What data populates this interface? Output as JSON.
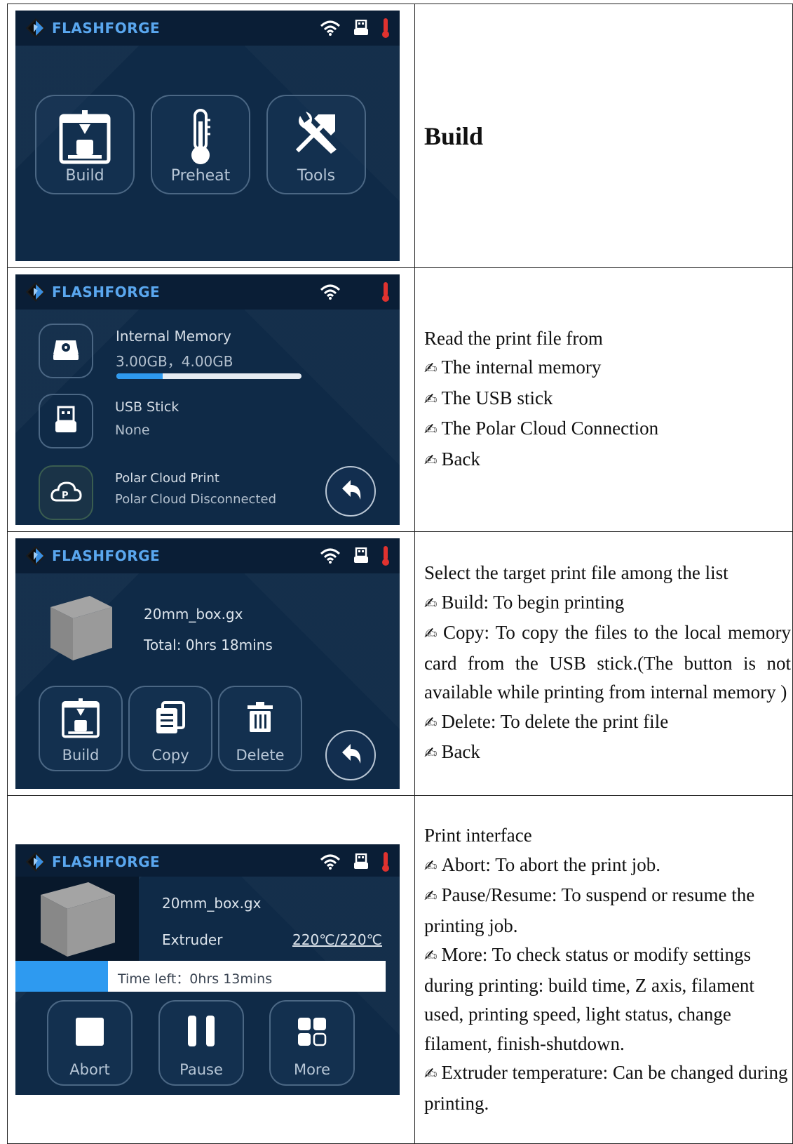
{
  "rows": [
    {
      "screen": {
        "brand": "FLASHFORGE",
        "tiles": [
          "Build",
          "Preheat",
          "Tools"
        ]
      },
      "heading": "Build"
    },
    {
      "screen": {
        "brand": "FLASHFORGE",
        "internal_title": "Internal Memory",
        "internal_value": "3.00GB，4.00GB",
        "internal_used_fraction": 0.25,
        "usb_title": "USB Stick",
        "usb_value": "None",
        "cloud_title": "Polar Cloud Print",
        "cloud_value": "Polar Cloud Disconnected"
      },
      "lines": [
        "Read the print file from"
      ],
      "bullets": [
        "The internal memory",
        "The USB stick",
        "The Polar Cloud Connection",
        "Back"
      ]
    },
    {
      "screen": {
        "brand": "FLASHFORGE",
        "file_name": "20mm_box.gx",
        "total": "Total: 0hrs 18mins",
        "tiles": [
          "Build",
          "Copy",
          "Delete"
        ]
      },
      "intro": "Select the target print file among the list",
      "bullets": [
        "Build: To begin printing",
        "Copy: To copy the files to the local memory card from the USB stick.(The button is not available while printing from internal memory )",
        "Delete: To delete the print file",
        "Back"
      ]
    },
    {
      "screen": {
        "brand": "FLASHFORGE",
        "file_name": "20mm_box.gx",
        "extruder_label": "Extruder",
        "extruder_value": "220℃/220℃",
        "time_left": "Time left：0hrs 13mins",
        "progress_fraction": 0.25,
        "tiles": [
          "Abort",
          "Pause",
          "More"
        ]
      },
      "intro": "Print interface",
      "bullets": [
        "Abort: To abort the print job.",
        "Pause/Resume: To suspend or resume the printing job.",
        "More: To check status or modify settings during printing: build time, Z axis, filament used, printing speed, light status, change filament, finish-shutdown.",
        "Extruder temperature: Can be changed during printing."
      ]
    }
  ],
  "icons": {
    "pen_bullet": "✍",
    "logo": "flashforge-logo-icon",
    "wifi": "wifi-icon",
    "usb": "usb-icon",
    "thermometer": "thermometer-icon",
    "back": "back-arrow-icon"
  },
  "colors": {
    "screen_bg": "#0f2a47",
    "topbar_bg": "#0a1e36",
    "brand": "#5aa7ef",
    "accent_blue": "#2e9af0",
    "thermo_red": "#e0322f"
  }
}
